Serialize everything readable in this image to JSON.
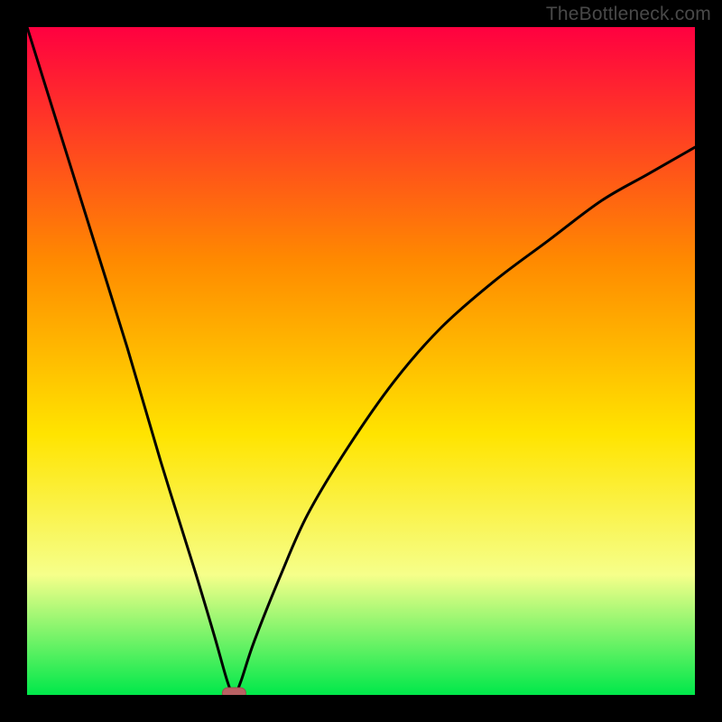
{
  "watermark": "TheBottleneck.com",
  "colors": {
    "frame": "#000000",
    "gradient_top": "#ff0040",
    "gradient_mid1": "#ff8a00",
    "gradient_mid2": "#ffe400",
    "gradient_mid3": "#f6ff8a",
    "gradient_bottom": "#00e84a",
    "curve": "#000000",
    "marker_fill": "#b96163",
    "marker_stroke": "#a14b4e"
  },
  "chart_data": {
    "type": "line",
    "title": "",
    "xlabel": "",
    "ylabel": "",
    "xlim": [
      0,
      100
    ],
    "ylim": [
      0,
      100
    ],
    "grid": false,
    "legend": false,
    "min_point": {
      "x": 31,
      "y": 0
    },
    "series": [
      {
        "name": "bottleneck-curve",
        "x": [
          0,
          5,
          10,
          15,
          20,
          25,
          28,
          30,
          31,
          32,
          34,
          38,
          42,
          48,
          55,
          62,
          70,
          78,
          86,
          93,
          100
        ],
        "y": [
          100,
          84,
          68,
          52,
          35,
          19,
          9,
          2,
          0,
          2,
          8,
          18,
          27,
          37,
          47,
          55,
          62,
          68,
          74,
          78,
          82
        ]
      }
    ],
    "marker": {
      "x": 31,
      "y": 0,
      "shape": "rounded-rect"
    }
  }
}
